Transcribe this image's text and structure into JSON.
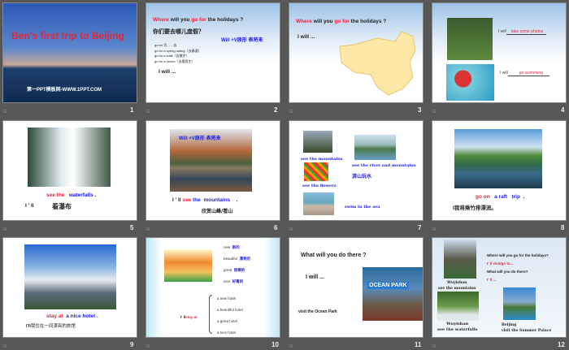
{
  "slides": [
    {
      "number": "1",
      "title": "Ben's first trip  to Beijing",
      "footer": "第一PPT模板网-WWW.1PPT.COM"
    },
    {
      "number": "2",
      "q_where": "Where",
      "q_will": "will you",
      "q_gofor": "go for",
      "q_rest": "the holidays ?",
      "cn_q": "你们要去哪儿度假？",
      "note": "Will +V原形  表将来",
      "lines": [
        "go for   为……去",
        "go for a spring outing（去春游）.",
        "go for a walk（去散步）.",
        "go for a doctor（去看医生）."
      ],
      "iwill": "I will ..."
    },
    {
      "number": "3",
      "q_where": "Where",
      "q_will": "will you",
      "q_gofor": "go for",
      "q_rest": "the holidays ?",
      "iwill": "I will ..."
    },
    {
      "number": "4",
      "iwill": "I will",
      "ans1": "take some photos",
      "ans2": "go swimming"
    },
    {
      "number": "5",
      "see": "see the",
      "obj": "waterfalls",
      "dot": ".",
      "ill": "I ' ll",
      "cn": "看瀑布"
    },
    {
      "number": "6",
      "note": "Will +V原形  表将来",
      "ill": "I ' ll",
      "see": "see",
      "the": "the",
      "obj": "mountains",
      "dot": ".",
      "cn": "欣赏山峰/看山"
    },
    {
      "number": "7",
      "c1": "see the mountains",
      "c2": "see the river and mountains",
      "c3": "游山玩水",
      "c4": "see the flowers",
      "c5": "swim in the sea"
    },
    {
      "number": "8",
      "goon": "go on",
      "raft": "a raft",
      "trip": "trip",
      "dot": ".",
      "ill": "I",
      "cn": "我将乘竹排漂流。"
    },
    {
      "number": "9",
      "stay": "stay at",
      "hotel": "a nice hotel",
      "dot": ".",
      "ill": "I'll",
      "cn": "我住在一间漂亮的旅馆"
    },
    {
      "number": "10",
      "words": [
        {
          "en": "new",
          "cn": "新的"
        },
        {
          "en": "beautiful",
          "cn": "漂亮的"
        },
        {
          "en": "great",
          "cn": "很棒的"
        },
        {
          "en": "nice",
          "cn": "好看的"
        }
      ],
      "ill": "I' ll",
      "stay": "stay at",
      "opts": [
        "a new hotel",
        "a beautiful hotel",
        "a great hotel",
        "a nice hotel"
      ]
    },
    {
      "number": "11",
      "q": "What will you  do there ?",
      "iwill": "I will  ...",
      "visit": "visit the Ocean Park",
      "sign": "OCEAN PARK"
    },
    {
      "number": "12",
      "q1": "Where will you go for the holidays?",
      "a1": "I' ll visit/go to...",
      "q2": "What will you do there?",
      "a2": "I' ll ...",
      "p1a": "Wuyishan",
      "p1b": "see the mountains",
      "p2a": "Wuyishan",
      "p2b": "see the waterfalls",
      "p3a": "Beijing",
      "p3b": "visit the Summer Palace"
    }
  ]
}
